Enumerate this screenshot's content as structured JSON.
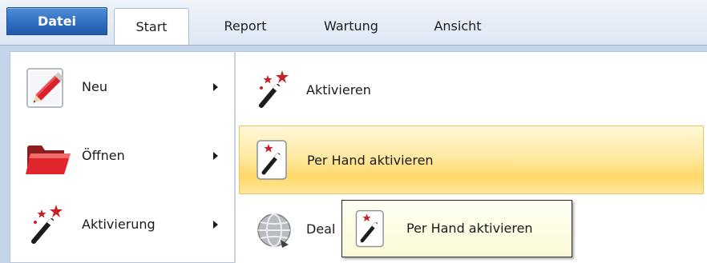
{
  "tabs": {
    "file": "Datei",
    "start": "Start",
    "report": "Report",
    "wartung": "Wartung",
    "ansicht": "Ansicht"
  },
  "file_menu": {
    "items": [
      {
        "label": "Neu",
        "icon": "new-document-pencil-icon",
        "has_submenu": true
      },
      {
        "label": "Öffnen",
        "icon": "open-folder-icon",
        "has_submenu": true
      },
      {
        "label": "Aktivierung",
        "icon": "magic-wand-icon",
        "has_submenu": true
      }
    ]
  },
  "submenu": {
    "items": [
      {
        "label": "Aktivieren",
        "icon": "magic-wand-stars-icon"
      },
      {
        "label": "Per Hand aktivieren",
        "icon": "magic-wand-card-icon",
        "state": "highlighted"
      },
      {
        "label": "Deal",
        "icon": "globe-icon"
      }
    ]
  },
  "tooltip": {
    "label": "Per Hand aktivieren",
    "icon": "magic-wand-card-icon"
  },
  "colors": {
    "file_tab": "#2f6fc0",
    "frame": "#c4d4e9",
    "highlight": "#ffd86a",
    "tooltip_bg": "#fffff3"
  }
}
